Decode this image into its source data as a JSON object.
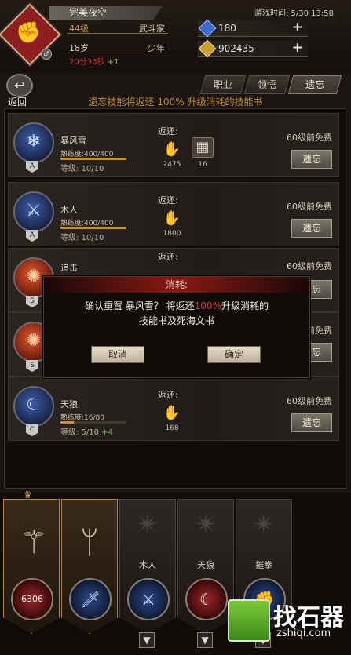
{
  "header": {
    "player_name": "完美夜空",
    "level_text": "44级",
    "class_name": "武斗家",
    "age_text": "18岁",
    "age_stage": "少年",
    "sub_time": "20分36秒",
    "sub_time_extra": "+1",
    "game_time": "游戏时间: 5/30 13:58",
    "resources": [
      {
        "icon": "blue-gem-icon",
        "value": "180",
        "color": "#4a7ad8"
      },
      {
        "icon": "gold-coin-icon",
        "value": "902435",
        "color": "#c8a030"
      }
    ]
  },
  "nav": {
    "back_label": "返回",
    "tabs": [
      {
        "label": "职业",
        "active": false
      },
      {
        "label": "领悟",
        "active": false
      },
      {
        "label": "遗忘",
        "active": true
      }
    ],
    "notice": "遗忘技能将返还 100% 升级消耗的技能书"
  },
  "skills": [
    {
      "name": "暴风雪",
      "grade": "A",
      "proficiency": "熟练度:400/400",
      "proficiency_fraction": 1.0,
      "level": "等级: 10/10",
      "level_bonus": "",
      "return_label": "返还:",
      "items": [
        {
          "icon": "claw-icon",
          "count": "2475"
        },
        {
          "icon": "rune-book-icon",
          "count": "16"
        }
      ],
      "free_text": "60级前免费",
      "button": "遗忘",
      "icon_style": "ice"
    },
    {
      "name": "木人",
      "grade": "A",
      "proficiency": "熟练度:400/400",
      "proficiency_fraction": 1.0,
      "level": "等级: 10/10",
      "level_bonus": "",
      "return_label": "返还:",
      "items": [
        {
          "icon": "claw-icon",
          "count": "1800"
        }
      ],
      "free_text": "60级前免费",
      "button": "遗忘",
      "icon_style": "ice"
    },
    {
      "name": "追击",
      "grade": "S",
      "proficiency": "",
      "proficiency_fraction": 0,
      "level": "",
      "level_bonus": "",
      "return_label": "返还:",
      "items": [],
      "free_text": "60级前免费",
      "button": "遗忘",
      "icon_style": "fire"
    },
    {
      "name": "",
      "grade": "S",
      "proficiency": "",
      "proficiency_fraction": 0,
      "level": "",
      "level_bonus": "",
      "return_label": "",
      "items": [],
      "free_text": "60级前免费",
      "button": "遗忘",
      "icon_style": "fire"
    },
    {
      "name": "天狼",
      "grade": "C",
      "proficiency": "熟练度:16/80",
      "proficiency_fraction": 0.2,
      "level": "等级: 5/10",
      "level_bonus": "+4",
      "return_label": "返还:",
      "items": [
        {
          "icon": "claw-icon",
          "count": "168"
        }
      ],
      "free_text": "60级前免费",
      "button": "遗忘",
      "icon_style": "ice"
    }
  ],
  "modal": {
    "title": "消耗:",
    "message_pre": "确认重置 暴风雪？ 将返还",
    "message_highlight": "100%",
    "message_post": "升级消耗的",
    "message_line2": "技能书及死海文书",
    "cancel": "取消",
    "confirm": "确定"
  },
  "bottom_slots": [
    {
      "label": "",
      "kind": "weapon",
      "orb_text": "6306"
    },
    {
      "label": "",
      "kind": "weapon",
      "orb_text": ""
    },
    {
      "label": "木人",
      "kind": "skill",
      "orb_text": ""
    },
    {
      "label": "天狼",
      "kind": "skill",
      "orb_text": ""
    },
    {
      "label": "摧拳",
      "kind": "skill",
      "orb_text": ""
    }
  ],
  "watermark": {
    "title": "找石器",
    "url": "zshiqi.com"
  }
}
